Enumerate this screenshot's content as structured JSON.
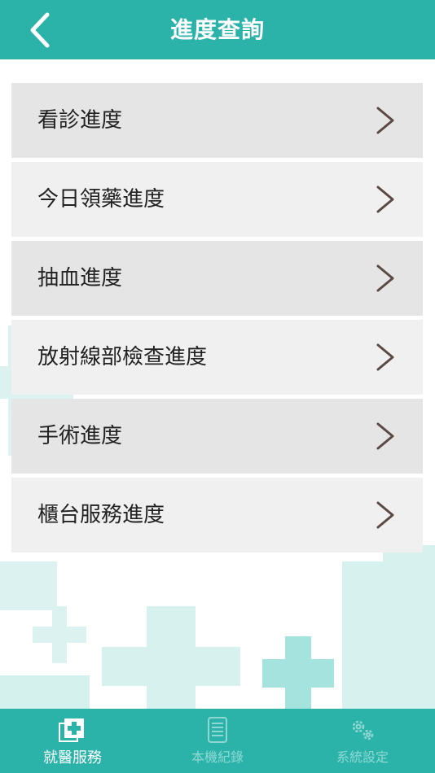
{
  "header": {
    "title": "進度查詢",
    "back_icon": "chevron-left-icon"
  },
  "menu": {
    "items": [
      {
        "label": "看診進度",
        "icon": "chevron-right-icon"
      },
      {
        "label": "今日領藥進度",
        "icon": "chevron-right-icon"
      },
      {
        "label": "抽血進度",
        "icon": "chevron-right-icon"
      },
      {
        "label": "放射線部檢查進度",
        "icon": "chevron-right-icon"
      },
      {
        "label": "手術進度",
        "icon": "chevron-right-icon"
      },
      {
        "label": "櫃台服務進度",
        "icon": "chevron-right-icon"
      }
    ]
  },
  "tabbar": {
    "tabs": [
      {
        "label": "就醫服務",
        "icon": "medical-cross-icon",
        "active": true
      },
      {
        "label": "本機紀錄",
        "icon": "record-list-icon",
        "active": false
      },
      {
        "label": "系統設定",
        "icon": "gears-icon",
        "active": false
      }
    ]
  },
  "colors": {
    "primary": "#2bb3aa",
    "item_dark": "#e5e5e5",
    "item_light": "#f0f0f0",
    "chevron": "#5a4a44",
    "inactive_tab": "#8fd8d2"
  }
}
